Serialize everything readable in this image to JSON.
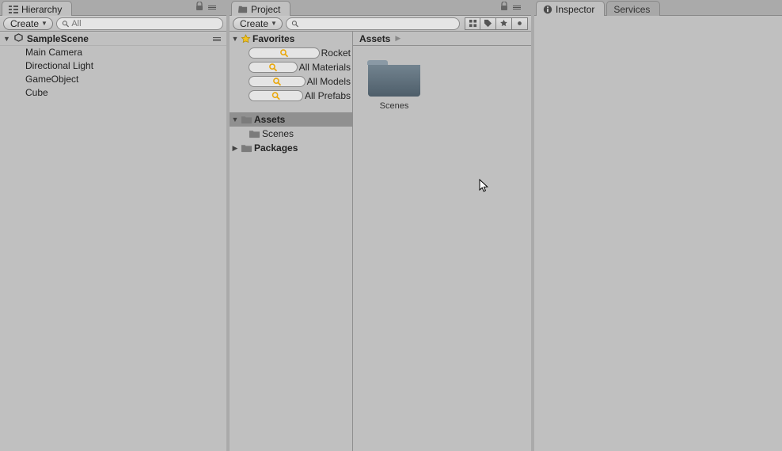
{
  "hierarchy": {
    "tab_label": "Hierarchy",
    "create_label": "Create",
    "search_placeholder": "All",
    "scene_name": "SampleScene",
    "items": [
      "Main Camera",
      "Directional Light",
      "GameObject",
      "Cube"
    ]
  },
  "project": {
    "tab_label": "Project",
    "create_label": "Create",
    "search_placeholder": "",
    "tree": {
      "favorites_label": "Favorites",
      "favorites": [
        "Rocket",
        "All Materials",
        "All Models",
        "All Prefabs"
      ],
      "assets_label": "Assets",
      "assets_children": [
        "Scenes"
      ],
      "packages_label": "Packages"
    },
    "breadcrumb": [
      "Assets"
    ],
    "grid_items": [
      {
        "name": "Scenes",
        "kind": "folder"
      }
    ]
  },
  "inspector": {
    "tab_label": "Inspector",
    "alt_tab_label": "Services"
  },
  "colors": {
    "selection": "#909090",
    "star": "#f3c321",
    "search_icon": "#e9a70a",
    "folder_thumb_top": "#8a99a5",
    "folder_thumb_body": "#5a6b78"
  }
}
